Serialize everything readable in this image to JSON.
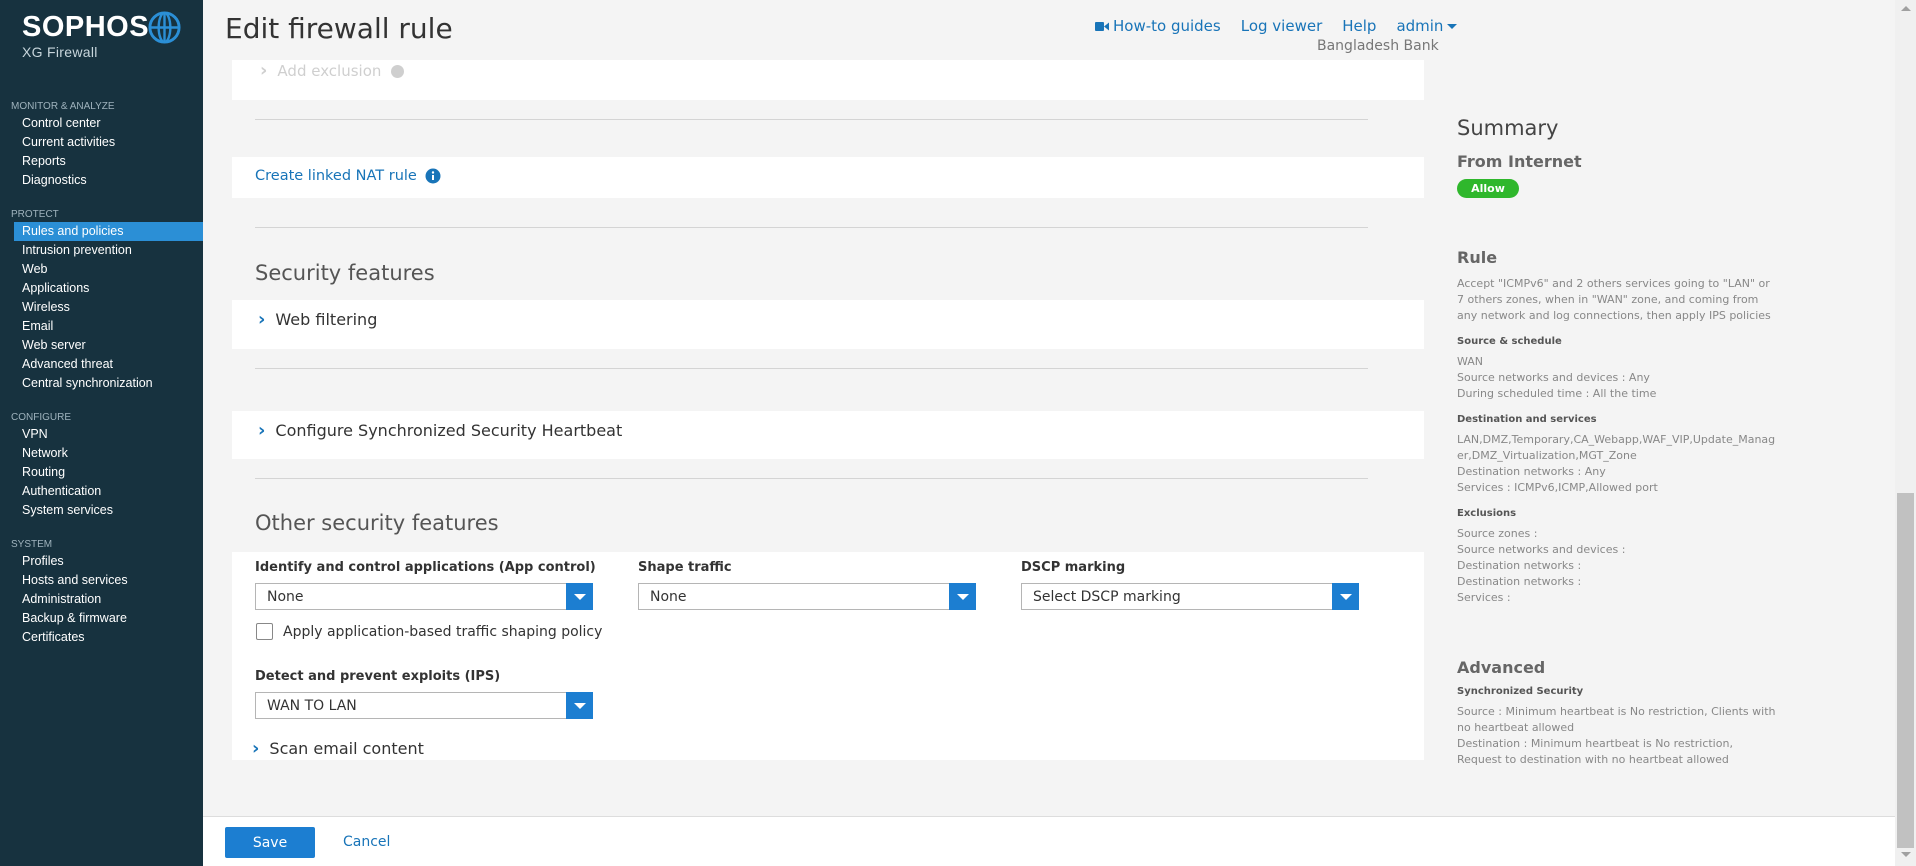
{
  "brand": {
    "name": "SOPHOS",
    "product": "XG Firewall"
  },
  "nav": {
    "sections": [
      {
        "title": "MONITOR & ANALYZE",
        "items": [
          "Control center",
          "Current activities",
          "Reports",
          "Diagnostics"
        ]
      },
      {
        "title": "PROTECT",
        "items": [
          "Rules and policies",
          "Intrusion prevention",
          "Web",
          "Applications",
          "Wireless",
          "Email",
          "Web server",
          "Advanced threat",
          "Central synchronization"
        ]
      },
      {
        "title": "CONFIGURE",
        "items": [
          "VPN",
          "Network",
          "Routing",
          "Authentication",
          "System services"
        ]
      },
      {
        "title": "SYSTEM",
        "items": [
          "Profiles",
          "Hosts and services",
          "Administration",
          "Backup & firmware",
          "Certificates"
        ]
      }
    ],
    "active": "Rules and policies"
  },
  "header": {
    "title": "Edit firewall rule",
    "links": {
      "howto": "How-to guides",
      "logviewer": "Log viewer",
      "help": "Help",
      "admin": "admin"
    },
    "organization": "Bangladesh Bank"
  },
  "main": {
    "add_exclusion": "Add exclusion",
    "linked_nat": "Create linked NAT rule",
    "security_features": {
      "heading": "Security features",
      "web_filtering": "Web filtering",
      "heartbeat": "Configure Synchronized Security Heartbeat"
    },
    "other_security": {
      "heading": "Other security features",
      "app_control": {
        "label": "Identify and control applications (App control)",
        "value": "None"
      },
      "shape_traffic": {
        "label": "Shape traffic",
        "value": "None"
      },
      "dscp": {
        "label": "DSCP marking",
        "value": "Select DSCP marking"
      },
      "app_shaping_checkbox": {
        "label": "Apply application-based traffic shaping policy",
        "checked": false
      },
      "ips": {
        "label": "Detect and prevent exploits (IPS)",
        "value": "WAN TO LAN"
      },
      "scan_email": "Scan email content"
    }
  },
  "summary": {
    "title": "Summary",
    "zone": "From Internet",
    "action_badge": "Allow",
    "rule": {
      "heading": "Rule",
      "description": "Accept \"ICMPv6\" and 2 others services going to \"LAN\" or 7 others zones, when in \"WAN\" zone, and coming from any network and log connections, then apply IPS policies"
    },
    "source_schedule": {
      "heading": "Source & schedule",
      "lines": [
        "WAN",
        "Source networks and devices : Any",
        "During scheduled time : All the time"
      ]
    },
    "destination_services": {
      "heading": "Destination and services",
      "lines": [
        "LAN,DMZ,Temporary,CA_Webapp,WAF_VIP,Update_Manager,DMZ_Virtualization,MGT_Zone",
        "Destination networks : Any",
        "Services : ICMPv6,ICMP,Allowed port"
      ]
    },
    "exclusions": {
      "heading": "Exclusions",
      "lines": [
        "Source zones :",
        "Source networks and devices :",
        "Destination networks :",
        "Destination networks :",
        "Services :"
      ]
    },
    "advanced": {
      "heading": "Advanced",
      "sub": "Synchronized Security",
      "lines": [
        "Source : Minimum heartbeat is No restriction, Clients with no heartbeat allowed",
        "Destination : Minimum heartbeat is No restriction, Request to destination with no heartbeat allowed"
      ]
    }
  },
  "footer": {
    "save": "Save",
    "cancel": "Cancel"
  },
  "colors": {
    "sidebar": "#17323f",
    "accent": "#1c7ed1",
    "allow": "#2fb72c"
  }
}
